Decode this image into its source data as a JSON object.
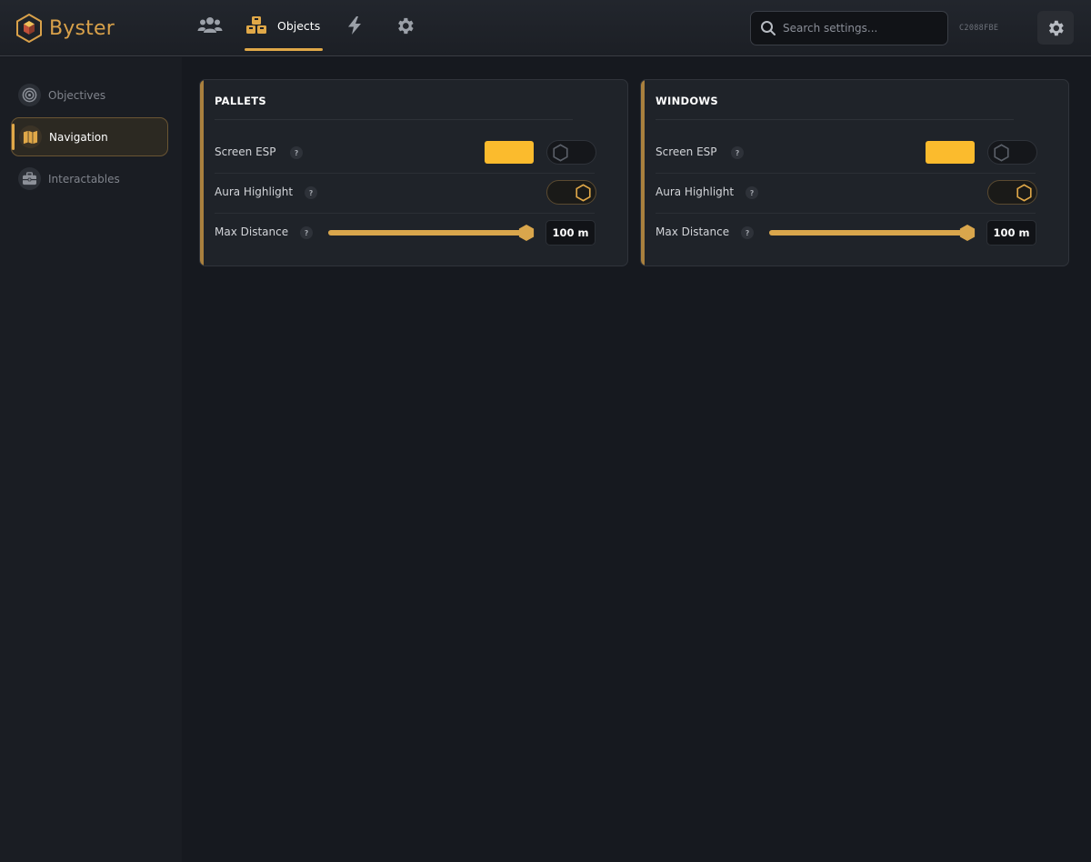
{
  "app": {
    "name": "Byster",
    "session_id": "C2088FBE"
  },
  "colors": {
    "accent": "#e0a848",
    "esp_color": "#fbbb2d",
    "background": "#16191f"
  },
  "topnav": {
    "tabs": [
      {
        "icon": "users-icon",
        "label": ""
      },
      {
        "icon": "cubes-icon",
        "label": "Objects",
        "active": true
      },
      {
        "icon": "bolt-icon",
        "label": ""
      },
      {
        "icon": "gear-icon",
        "label": ""
      }
    ]
  },
  "search": {
    "placeholder": "Search settings..."
  },
  "sidebar": {
    "items": [
      {
        "icon": "target-icon",
        "label": "Objectives"
      },
      {
        "icon": "map-icon",
        "label": "Navigation",
        "active": true
      },
      {
        "icon": "toolbox-icon",
        "label": "Interactables"
      }
    ]
  },
  "cards": [
    {
      "title": "PALLETS",
      "screen_esp": {
        "label": "Screen ESP",
        "color": "#fbbb2d",
        "enabled": false
      },
      "aura": {
        "label": "Aura Highlight",
        "enabled": true
      },
      "distance": {
        "label": "Max Distance",
        "value": "100 m",
        "fraction": 1.0
      }
    },
    {
      "title": "WINDOWS",
      "screen_esp": {
        "label": "Screen ESP",
        "color": "#fbbb2d",
        "enabled": false
      },
      "aura": {
        "label": "Aura Highlight",
        "enabled": true
      },
      "distance": {
        "label": "Max Distance",
        "value": "100 m",
        "fraction": 1.0
      }
    }
  ],
  "help_glyph": "?"
}
